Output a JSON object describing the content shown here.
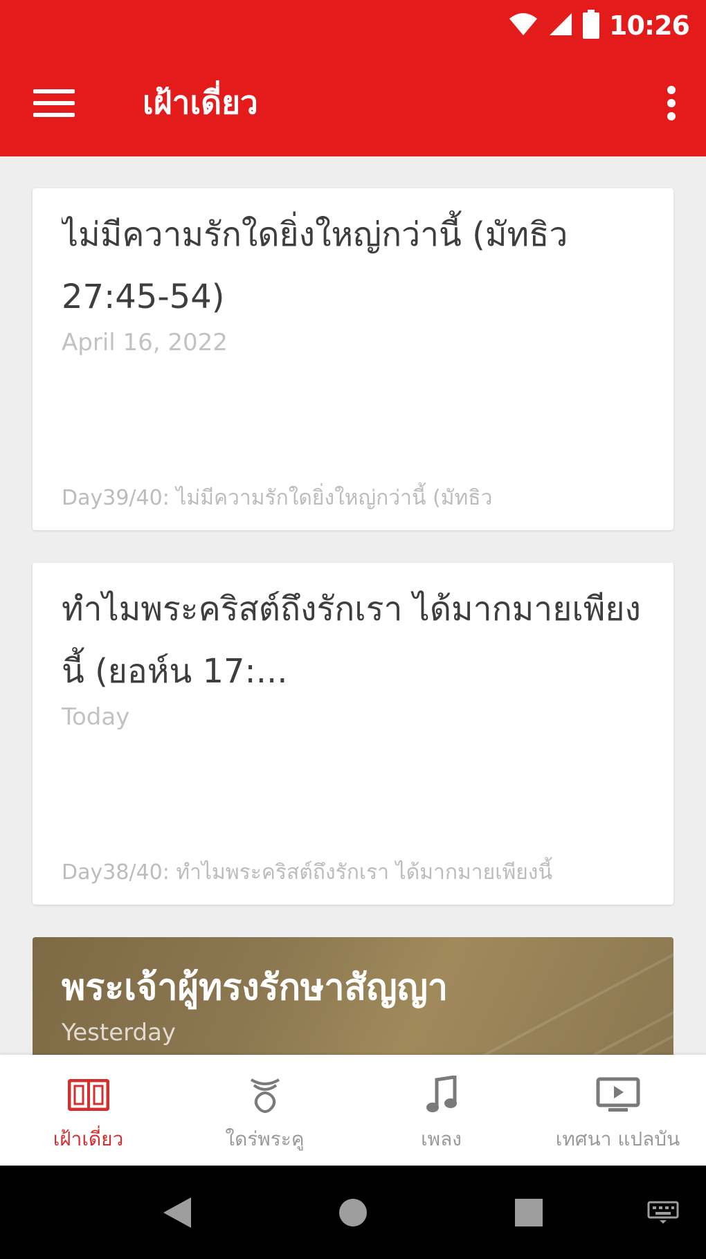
{
  "status_bar": {
    "time": "10:26",
    "icons": [
      "wifi-icon",
      "cell-signal-icon",
      "battery-icon"
    ]
  },
  "app_bar": {
    "title": "เฝ้าเดี่ยว",
    "menu_icon": "hamburger-menu-icon",
    "overflow_icon": "more-vert-icon"
  },
  "feed": {
    "cards": [
      {
        "title": "ไม่มีความรักใดยิ่งใหญ่กว่านี้ (มัทธิว 27:45-54)",
        "date": "April 16, 2022",
        "excerpt": "Day39/40: ไม่มีความรักใดยิ่งใหญ่กว่านี้ (มัทธิว"
      },
      {
        "title": "ทำไมพระคริสต์ถึงรักเรา ได้มากมายเพียงนี้ (ยอห์น 17:...",
        "date": "Today",
        "excerpt": "Day38/40: ทำไมพระคริสต์ถึงรักเรา ได้มากมายเพียงนี้"
      },
      {
        "title": "พระเจ้าผู้ทรงรักษาสัญญา",
        "date": "Yesterday"
      }
    ]
  },
  "bottom_nav": {
    "items": [
      {
        "label": "เฝ้าเดี่ยว",
        "icon": "book-icon",
        "active": true
      },
      {
        "label": "ใดร่พระคู",
        "icon": "hands-icon",
        "active": false
      },
      {
        "label": "เพลง",
        "icon": "music-note-icon",
        "active": false
      },
      {
        "label": "เทศนา แปลบัน",
        "icon": "tv-play-icon",
        "active": false
      }
    ]
  },
  "colors": {
    "primary": "#e31b1b",
    "active_nav": "#d32f2f",
    "inactive_nav": "#9a9a9a",
    "background": "#eeeeee"
  },
  "system_nav": {
    "icons": [
      "back-icon",
      "home-icon",
      "recents-icon",
      "keyboard-icon"
    ]
  }
}
